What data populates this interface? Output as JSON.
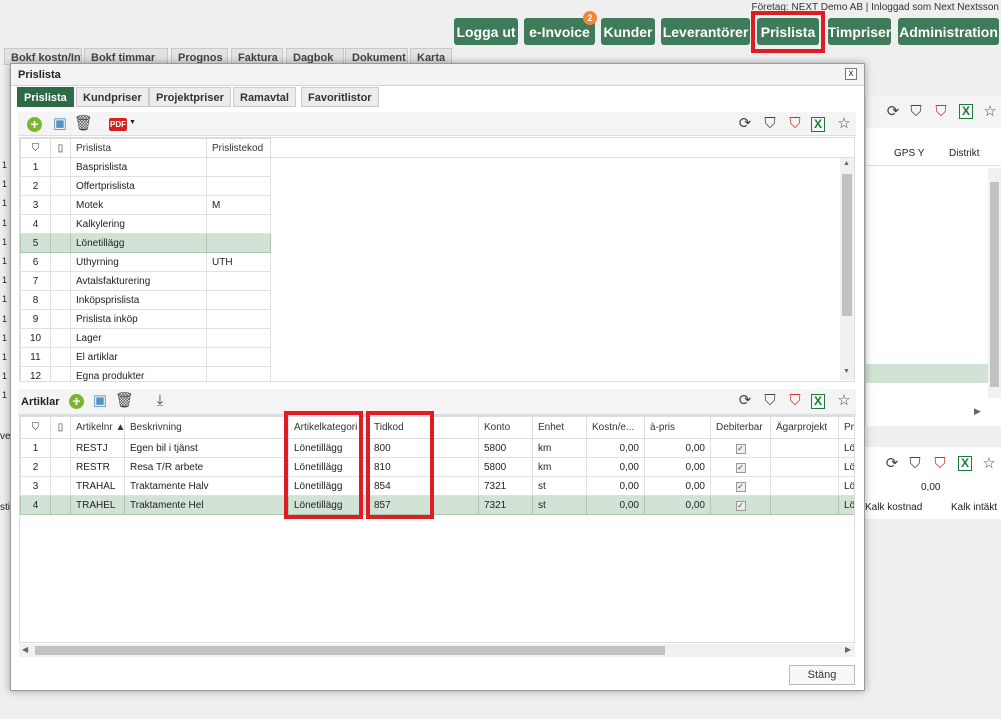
{
  "company_info": "Företag: NEXT Demo AB | Inloggad som Next Nextsson",
  "topnav": {
    "logga_ut": "Logga ut",
    "einvoice": "e-Invoice",
    "einvoice_badge": "2",
    "kunder": "Kunder",
    "leverantorer": "Leverantörer",
    "prislista": "Prislista",
    "timpriser": "Timpriser",
    "administration": "Administration"
  },
  "bg_tabs": [
    "Bokf kostn/Int",
    "Bokf timmar",
    "Prognos",
    "Faktura",
    "Dagbok",
    "Dokument",
    "Karta"
  ],
  "bg": {
    "gps_y": "GPS Y",
    "distrikt": "Distrikt",
    "value_000": "0,00",
    "kalk_kostnad": "Kalk kostnad",
    "kalk_intakt": "Kalk intäkt",
    "left_ones": [
      "1",
      "1",
      "1",
      "1",
      "1",
      "1",
      "1",
      "1",
      "1",
      "1",
      "1",
      "1",
      "1"
    ],
    "ve": "ve",
    "sti": "sti"
  },
  "dialog": {
    "title": "Prislista",
    "close": "x",
    "tabs": [
      "Prislista",
      "Kundpriser",
      "Projektpriser",
      "Ramavtal",
      "Favoritlistor"
    ],
    "pdf_label": "PDF",
    "prislista_table": {
      "headers": [
        "Prislista",
        "Prislistekod"
      ],
      "rows": [
        {
          "n": "1",
          "name": "Basprislista",
          "code": ""
        },
        {
          "n": "2",
          "name": "Offertprislista",
          "code": ""
        },
        {
          "n": "3",
          "name": "Motek",
          "code": "M"
        },
        {
          "n": "4",
          "name": "Kalkylering",
          "code": ""
        },
        {
          "n": "5",
          "name": "Lönetillägg",
          "code": ""
        },
        {
          "n": "6",
          "name": "Uthyrning",
          "code": "UTH"
        },
        {
          "n": "7",
          "name": "Avtalsfakturering",
          "code": ""
        },
        {
          "n": "8",
          "name": "Inköpsprislista",
          "code": ""
        },
        {
          "n": "9",
          "name": "Prislista inköp",
          "code": ""
        },
        {
          "n": "10",
          "name": "Lager",
          "code": ""
        },
        {
          "n": "11",
          "name": "El artiklar",
          "code": ""
        },
        {
          "n": "12",
          "name": "Egna produkter",
          "code": ""
        }
      ]
    },
    "artiklar": {
      "label": "Artiklar",
      "headers": [
        "Artikelnr",
        "Beskrivning",
        "Artikelkategori",
        "Tidkod",
        "Konto",
        "Enhet",
        "Kostn/e...",
        "à-pris",
        "Debiterbar",
        "Ägarprojekt",
        "Prisl"
      ],
      "rows": [
        {
          "n": "1",
          "nr": "RESTJ",
          "desc": "Egen bil i tjänst",
          "kat": "Lönetillägg",
          "tid": "800",
          "konto": "5800",
          "enhet": "km",
          "kost": "0,00",
          "apris": "0,00",
          "deb": "✓",
          "agar": "",
          "prisl": "Löne"
        },
        {
          "n": "2",
          "nr": "RESTR",
          "desc": "Resa T/R arbete",
          "kat": "Lönetillägg",
          "tid": "810",
          "konto": "5800",
          "enhet": "km",
          "kost": "0,00",
          "apris": "0,00",
          "deb": "✓",
          "agar": "",
          "prisl": "Löne"
        },
        {
          "n": "3",
          "nr": "TRAHAL",
          "desc": "Traktamente Halv",
          "kat": "Lönetillägg",
          "tid": "854",
          "konto": "7321",
          "enhet": "st",
          "kost": "0,00",
          "apris": "0,00",
          "deb": "✓",
          "agar": "",
          "prisl": "Löne"
        },
        {
          "n": "4",
          "nr": "TRAHEL",
          "desc": "Traktamente Hel",
          "kat": "Lönetillägg",
          "tid": "857",
          "konto": "7321",
          "enhet": "st",
          "kost": "0,00",
          "apris": "0,00",
          "deb": "✓",
          "agar": "",
          "prisl": "Löne"
        }
      ]
    },
    "stang": "Stäng"
  },
  "colors": {
    "accent": "#3e7b58",
    "highlight": "#e01b24",
    "selected_row": "#d2e3d6",
    "badge": "#f0883a"
  }
}
